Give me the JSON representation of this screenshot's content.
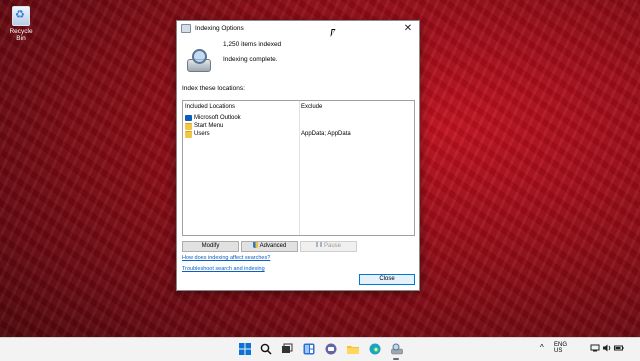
{
  "desktop": {
    "recycle_bin_label": "Recycle Bin"
  },
  "dialog": {
    "title": "Indexing Options",
    "close_glyph": "✕",
    "items_indexed": "1,250 items indexed",
    "status": "Indexing complete.",
    "section_label": "Index these locations:",
    "table": {
      "headers": [
        "Included Locations",
        "Exclude"
      ],
      "rows": [
        {
          "location": "Microsoft Outlook",
          "exclude": "",
          "icon": "outlook-icon"
        },
        {
          "location": "Start Menu",
          "exclude": "",
          "icon": "folder-icon"
        },
        {
          "location": "Users",
          "exclude": "AppData; AppData",
          "icon": "folder-icon"
        }
      ]
    },
    "buttons": {
      "modify": "Modify",
      "advanced": "Advanced",
      "pause": "Pause",
      "close": "Close"
    },
    "links": {
      "how_indexing": "How does indexing affect searches?",
      "troubleshoot": "Troubleshoot search and indexing"
    }
  },
  "taskbar": {
    "icons": [
      "windows-start-icon",
      "search-icon",
      "task-view-icon",
      "widgets-icon",
      "chat-icon",
      "file-explorer-icon",
      "edge-icon",
      "indexing-options-icon"
    ],
    "tray": {
      "chevron": "^",
      "lang_line1": "ENG",
      "lang_line2": "US"
    }
  },
  "colors": {
    "accent": "#0078d4",
    "link": "#0a5fc4",
    "wallpaper": "#9a0d18"
  }
}
